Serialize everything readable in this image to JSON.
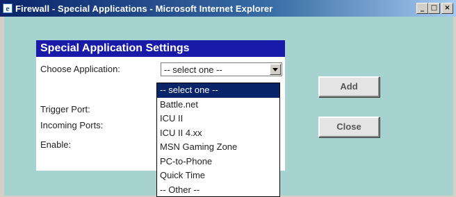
{
  "window": {
    "title": "Firewall - Special Applications - Microsoft Internet Explorer",
    "icon": "ie-icon",
    "controls": {
      "minimize": "_",
      "maximize": "□",
      "close": "×"
    }
  },
  "panel": {
    "title": "Special Application Settings",
    "choose_label": "Choose Application:",
    "trigger_label": "Trigger Port:",
    "incoming_label": "Incoming Ports:",
    "enable_label": "Enable:"
  },
  "select": {
    "value": "-- select one --",
    "options": [
      "-- select one --",
      "Battle.net",
      "ICU II",
      "ICU II 4.xx",
      "MSN Gaming Zone",
      "PC-to-Phone",
      "Quick Time",
      "-- Other --"
    ],
    "selected_index": 0
  },
  "buttons": {
    "add": "Add",
    "close": "Close"
  },
  "colors": {
    "titlebar": "#0a246a",
    "background": "#a6d2d0",
    "panel_header": "#1a1aa8",
    "highlight": "#0a246a"
  }
}
